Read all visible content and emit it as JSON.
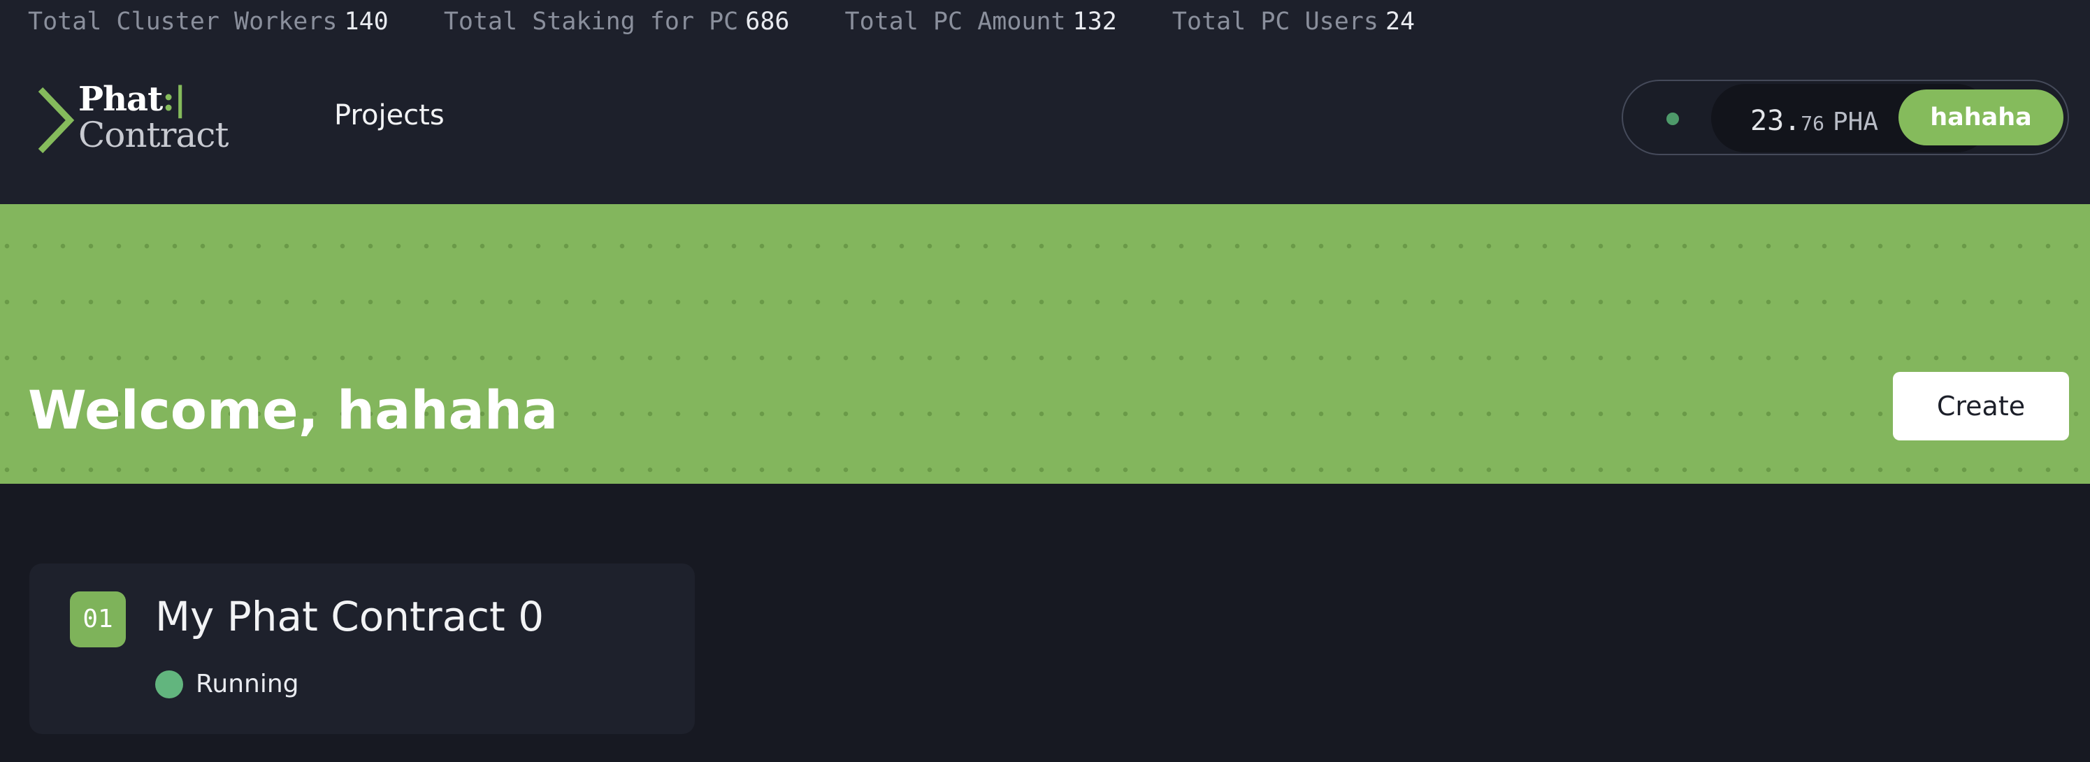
{
  "stats": [
    {
      "label": "Total Cluster Workers",
      "value": "140"
    },
    {
      "label": "Total Staking for PC",
      "value": "686"
    },
    {
      "label": "Total PC Amount",
      "value": "132"
    },
    {
      "label": "Total PC Users",
      "value": "24"
    }
  ],
  "logo": {
    "line1": "Phat",
    "line1_accent": ":|",
    "line2": "Contract"
  },
  "nav": {
    "projects_label": "Projects"
  },
  "account": {
    "balance_int": "23.",
    "balance_dec": "76",
    "unit": "PHA",
    "username": "hahaha"
  },
  "banner": {
    "welcome": "Welcome, hahaha",
    "create_label": "Create"
  },
  "projects": [
    {
      "number": "01",
      "title": "My Phat Contract 0",
      "status": "Running"
    }
  ],
  "colors": {
    "accent": "#83b65d",
    "background": "#171922",
    "header": "#1d202b",
    "status_running": "#62b57e"
  }
}
